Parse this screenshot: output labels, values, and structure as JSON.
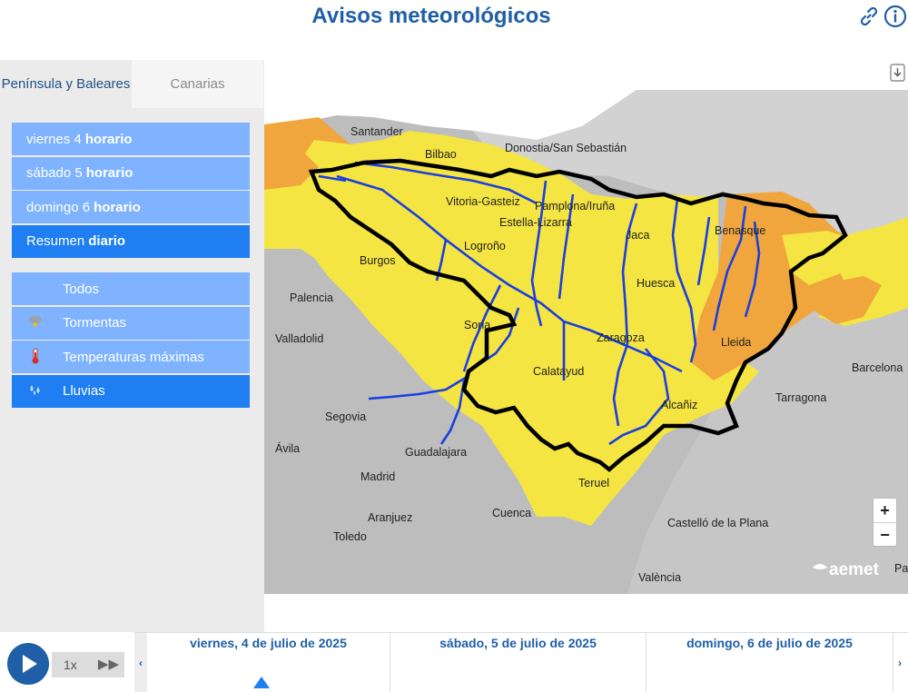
{
  "header": {
    "title": "Avisos meteorológicos",
    "icons": [
      "link-icon",
      "info-icon"
    ]
  },
  "region_tabs": [
    {
      "label": "Península y Baleares",
      "active": true
    },
    {
      "label": "Canarias",
      "active": false
    }
  ],
  "day_menu": [
    {
      "day": "viernes 4",
      "mode": "horario",
      "selected": false
    },
    {
      "day": "sábado 5",
      "mode": "horario",
      "selected": false
    },
    {
      "day": "domingo 6",
      "mode": "horario",
      "selected": false
    },
    {
      "day": "Resumen",
      "mode": "diario",
      "selected": true
    }
  ],
  "phenomenon_menu": [
    {
      "label": "Todos",
      "icon": "",
      "selected": false
    },
    {
      "label": "Tormentas",
      "icon": "storm-icon",
      "selected": false
    },
    {
      "label": "Temperaturas máximas",
      "icon": "thermometer-icon",
      "selected": false
    },
    {
      "label": "Lluvias",
      "icon": "rain-icon",
      "selected": true
    }
  ],
  "map": {
    "cities": [
      "Santander",
      "Bilbao",
      "Donostia/San Sebastián",
      "Vitoria-Gasteiz",
      "Pamplona/Iruña",
      "Estella-Lizarra",
      "Logroño",
      "Jaca",
      "Benasque",
      "Burgos",
      "Palencia",
      "Huesca",
      "Soria",
      "Valladolid",
      "Zaragoza",
      "Lleida",
      "Barcelona",
      "Calatayud",
      "Tarragona",
      "Alcañiz",
      "Segovia",
      "Ávila",
      "Guadalajara",
      "Teruel",
      "Madrid",
      "Cuenca",
      "Aranjuez",
      "Toledo",
      "Castelló de la Plana",
      "València",
      "Pa"
    ],
    "legend_colors": {
      "yellow": "#f4e542",
      "orange": "#f0a63c",
      "basin_border": "#000000",
      "rivers": "#1a3fe0"
    },
    "logo": "aemet",
    "zoom_in": "+",
    "zoom_out": "−"
  },
  "playback": {
    "speed": "1x"
  },
  "timeline": {
    "days": [
      "viernes, 4 de julio de 2025",
      "sábado, 5 de julio de 2025",
      "domingo, 6 de julio de 2025"
    ],
    "current_index": 0
  }
}
